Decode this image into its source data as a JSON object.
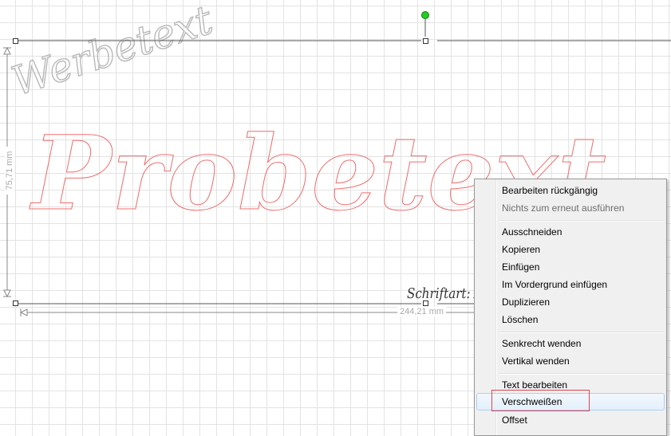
{
  "canvas": {
    "height_dimension": "75,71 mm",
    "width_dimension": "244,21 mm",
    "design_text": "Probetext",
    "watermark_text": "Werbetext",
    "font_credit": "Schriftart: Acrobe Script",
    "colors": {
      "grid": "#e3e3e3",
      "design_stroke": "#ef6f6f",
      "watermark": "#b9b9b9",
      "rotation_handle": "#22cc22",
      "highlight": "#d9464f"
    }
  },
  "context_menu": {
    "items": [
      {
        "label": "Bearbeiten rückgängig",
        "enabled": true
      },
      {
        "label": "Nichts zum erneut ausführen",
        "enabled": false
      },
      {
        "label": "Ausschneiden",
        "enabled": true
      },
      {
        "label": "Kopieren",
        "enabled": true
      },
      {
        "label": "Einfügen",
        "enabled": true
      },
      {
        "label": "Im Vordergrund einfügen",
        "enabled": true
      },
      {
        "label": "Duplizieren",
        "enabled": true
      },
      {
        "label": "Löschen",
        "enabled": true
      },
      {
        "label": "Senkrecht wenden",
        "enabled": true
      },
      {
        "label": "Vertikal wenden",
        "enabled": true
      },
      {
        "label": "Text bearbeiten",
        "enabled": true
      },
      {
        "label": "Verschweißen",
        "enabled": true,
        "hovered": true
      },
      {
        "label": "Offset",
        "enabled": true
      }
    ]
  }
}
